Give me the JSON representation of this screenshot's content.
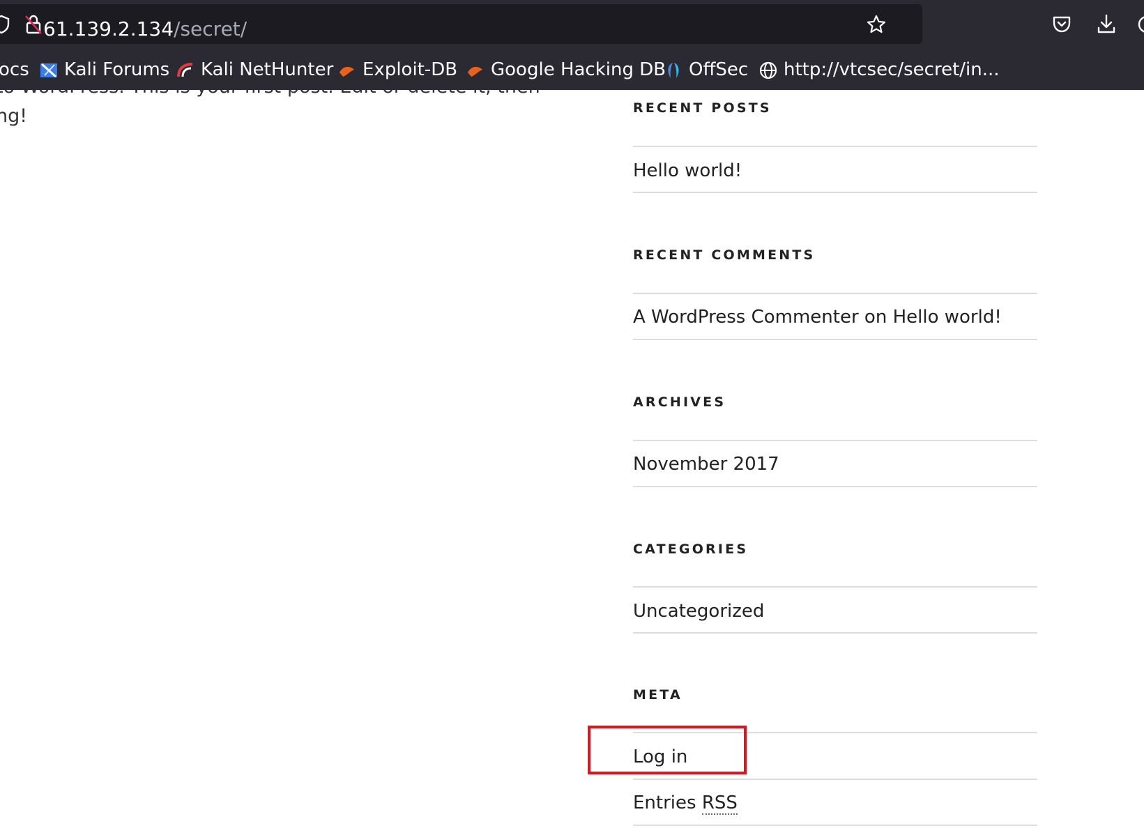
{
  "browser": {
    "url_host": "61.139.2.134",
    "url_path": "/secret/",
    "bookmarks": [
      {
        "label": "ocs"
      },
      {
        "label": "Kali Forums"
      },
      {
        "label": "Kali NetHunter"
      },
      {
        "label": "Exploit-DB"
      },
      {
        "label": "Google Hacking DB"
      },
      {
        "label": "OffSec"
      },
      {
        "label": "http://vtcsec/secret/in..."
      }
    ],
    "icons": [
      "shield-icon",
      "lock-slash-icon",
      "star-icon",
      "pocket-icon",
      "download-icon",
      "globe-icon"
    ]
  },
  "post": {
    "line1": "to WordPress. This is your first post. Edit or delete it, then",
    "line2": "ng!"
  },
  "sidebar": {
    "recent_posts": {
      "title": "RECENT POSTS",
      "items": [
        "Hello world!"
      ]
    },
    "recent_comments": {
      "title": "RECENT COMMENTS",
      "author": "A WordPress Commenter",
      "connector": "on",
      "post": "Hello world!"
    },
    "archives": {
      "title": "ARCHIVES",
      "items": [
        "November 2017"
      ]
    },
    "categories": {
      "title": "CATEGORIES",
      "items": [
        "Uncategorized"
      ]
    },
    "meta": {
      "title": "META",
      "login": "Log in",
      "entries": "Entries",
      "rss": "RSS"
    }
  },
  "colors": {
    "chrome_bg": "#2b2a33",
    "urlbar_bg": "#1c1b22",
    "highlight": "#e0141e",
    "text": "#222222"
  }
}
